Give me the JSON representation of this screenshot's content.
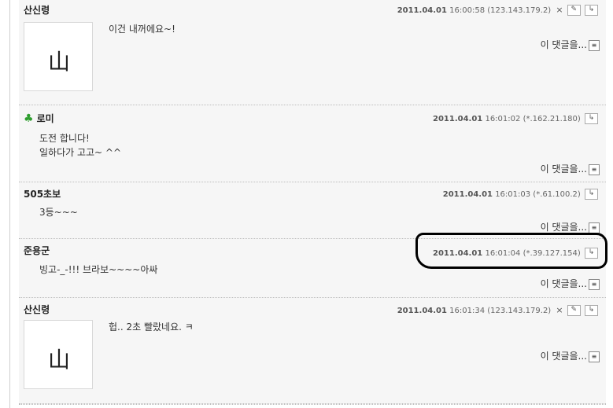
{
  "reply_label": "이 댓글을...",
  "comments": [
    {
      "name": "산신령",
      "date": "2011.04.01",
      "time": "16:00:58",
      "ip": "(123.143.179.2)",
      "delete": "×",
      "avatar_glyph": "山",
      "body": "이건 내꺼에요~!"
    },
    {
      "name": "로미",
      "date": "2011.04.01",
      "time": "16:01:02",
      "ip": "(*.162.21.180)",
      "body": "도전 합니다!\n일하다가 고고~ ^^"
    },
    {
      "name": "505초보",
      "date": "2011.04.01",
      "time": "16:01:03",
      "ip": "(*.61.100.2)",
      "body": "3등~~~"
    },
    {
      "name": "준용군",
      "date": "2011.04.01",
      "time": "16:01:04",
      "ip": "(*.39.127.154)",
      "body": "빙고-_-!!! 브라보~~~~아싸"
    },
    {
      "name": "산신령",
      "date": "2011.04.01",
      "time": "16:01:34",
      "ip": "(123.143.179.2)",
      "delete": "×",
      "avatar_glyph": "山",
      "body": "헙.. 2초 빨랐네요. ㅋ"
    }
  ]
}
